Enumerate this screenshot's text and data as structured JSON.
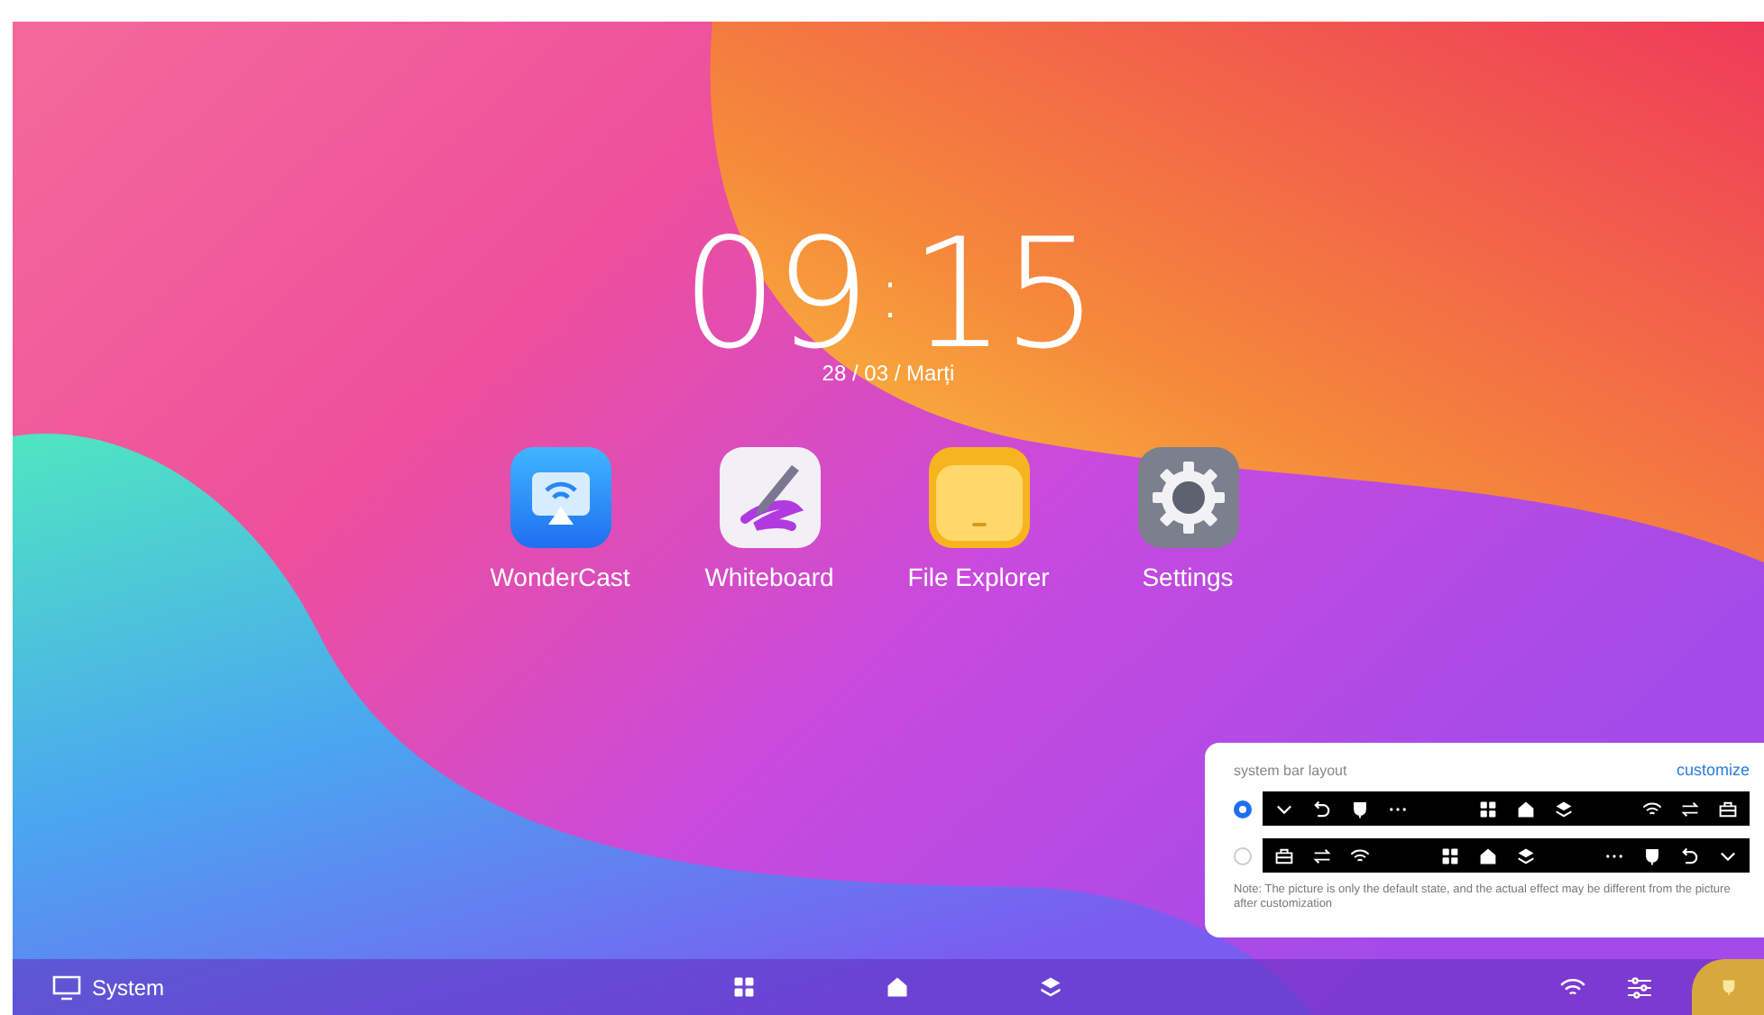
{
  "clock": {
    "time_hours": "09",
    "separator": ":",
    "time_minutes": "15",
    "date": "28 / 03 / Marți"
  },
  "apps": [
    {
      "label": "WonderCast",
      "kind": "cast"
    },
    {
      "label": "Whiteboard",
      "kind": "pen"
    },
    {
      "label": "File Explorer",
      "kind": "folder"
    },
    {
      "label": "Settings",
      "kind": "gear"
    }
  ],
  "layout_panel": {
    "title": "system bar layout",
    "customize_link": "customize",
    "options": [
      {
        "selected": true,
        "kind": "controls-left"
      },
      {
        "selected": false,
        "kind": "controls-right"
      }
    ],
    "note": "Note: The picture is only the default state, and the actual effect may be different from the picture after customization"
  },
  "taskbar": {
    "system_label": "System"
  }
}
